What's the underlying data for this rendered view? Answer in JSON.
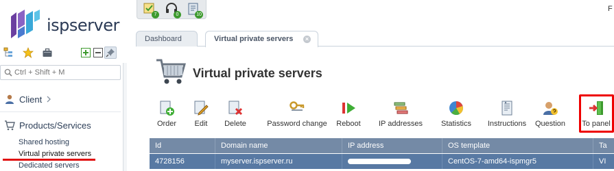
{
  "brand": {
    "name": "ispserver"
  },
  "sidebar": {
    "search_placeholder": "Ctrl + Shift + M",
    "client_label": "Client",
    "products_label": "Products/Services",
    "sub_items": [
      "Shared hosting",
      "Virtual private servers",
      "Dedicated servers"
    ]
  },
  "notifications": [
    {
      "icon": "tasks-icon",
      "count": "7"
    },
    {
      "icon": "support-headset-icon",
      "count": "0"
    },
    {
      "icon": "invoice-icon",
      "count": "10"
    }
  ],
  "header": {
    "corner_text": "F"
  },
  "tabs": [
    {
      "label": "Dashboard",
      "active": false
    },
    {
      "label": "Virtual private servers",
      "active": true
    }
  ],
  "page": {
    "title": "Virtual private servers"
  },
  "toolbar": [
    {
      "label": "Order",
      "icon": "order-add-icon"
    },
    {
      "label": "Edit",
      "icon": "edit-icon"
    },
    {
      "label": "Delete",
      "icon": "delete-icon"
    },
    {
      "label": "Password change",
      "icon": "key-icon"
    },
    {
      "label": "Reboot",
      "icon": "reboot-icon"
    },
    {
      "label": "IP addresses",
      "icon": "ip-addresses-icon"
    },
    {
      "label": "Statistics",
      "icon": "pie-chart-icon"
    },
    {
      "label": "Instructions",
      "icon": "instructions-icon"
    },
    {
      "label": "Question",
      "icon": "question-user-icon"
    },
    {
      "label": "To panel",
      "icon": "to-panel-icon"
    }
  ],
  "table": {
    "columns": [
      "Id",
      "Domain name",
      "IP address",
      "OS template",
      "Ta"
    ],
    "rows": [
      {
        "id": "4728156",
        "domain": "myserver.ispserver.ru",
        "ip": "",
        "os": "CentOS-7-amd64-ispmgr5",
        "tariff": "VI"
      }
    ]
  },
  "colors": {
    "highlight": "#e00000",
    "table_header": "#748aa6",
    "selected_row": "#5879a3"
  }
}
